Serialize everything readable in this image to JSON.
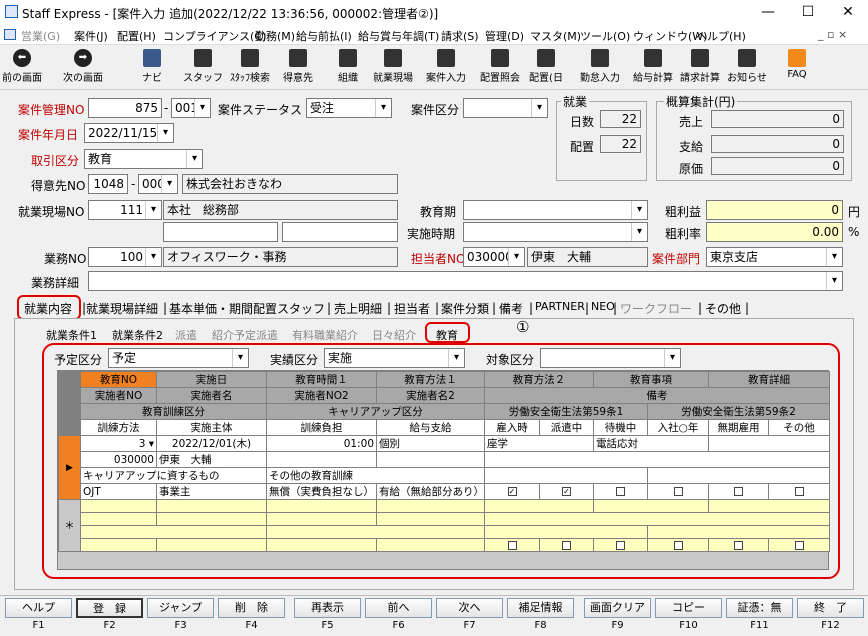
{
  "window": {
    "title": "Staff Express - [案件入力 追加(2022/12/22 13:36:56, 000002:管理者②)]",
    "min": "—",
    "max": "☐",
    "close": "✕"
  },
  "menu": [
    "営業(G)",
    "案件(J)",
    "配置(H)",
    "コンプライアンス(C)",
    "勤務(M)",
    "給与前払(I)",
    "給与賞与年調(T)",
    "請求(S)",
    "管理(D)",
    "マスタ(M)",
    "ツール(O)",
    "ウィンドウ(W)",
    "ヘルプ(H)"
  ],
  "mdi_controls": "_ ▫ ×",
  "toolbar": [
    "前の画面",
    "次の画面",
    "ナビ",
    "スタッフ",
    "ｽﾀｯﾌ検索",
    "得意先",
    "組織",
    "就業現場",
    "案件入力",
    "配置照会",
    "配置(日",
    "勤怠入力",
    "給与計算",
    "請求計算",
    "お知らせ",
    "FAQ"
  ],
  "form": {
    "anken_kanri_no_label": "案件管理NO",
    "anken_kanri_no": "875",
    "anken_kanri_sub": "001",
    "status_label": "案件ステータス",
    "status": "受注",
    "kubun_label": "案件区分",
    "kubun": "",
    "date_label": "案件年月日",
    "date": "2022/11/15",
    "torihiki_label": "取引区分",
    "torihiki": "教育",
    "tokuisaki_label": "得意先NO",
    "tokuisaki_no": "1048",
    "tokuisaki_sub": "000",
    "tokuisaki_name": "株式会社おきなわ",
    "genba_label": "就業現場NO",
    "genba_no": "111",
    "genba_name": "本社　総務部",
    "kyoiku_ki_label": "教育期",
    "kyoiku_ki": "",
    "jisshi_label": "実施時期",
    "jisshi": "",
    "gyomu_label": "業務NO",
    "gyomu_no": "100",
    "gyomu_name": "オフィスワーク・事務",
    "tanto_label": "担当者NO",
    "tanto_no": "030000",
    "tanto_name": "伊東　大輔",
    "bumon_label": "案件部門",
    "bumon": "東京支店",
    "shosai_label": "業務詳細",
    "shosai": ""
  },
  "shugyo": {
    "title": "就業",
    "nissu_label": "日数",
    "nissu": "22",
    "haichi_label": "配置",
    "haichi": "22"
  },
  "gaisan": {
    "title": "概算集計(円)",
    "uriage_label": "売上",
    "uriage": "0",
    "shikyu_label": "支給",
    "shikyu": "0",
    "genka_label": "原価",
    "genka": "0"
  },
  "arari": {
    "label": "粗利益",
    "value": "0",
    "unit": "円",
    "rate_label": "粗利率",
    "rate": "0.00",
    "rate_unit": "%"
  },
  "tabs": [
    "就業内容",
    "就業現場詳細",
    "基本単価・期間配置スタッフ",
    "売上明細",
    "担当者",
    "案件分類",
    "備考",
    "PARTNER",
    "NEO",
    "ワークフロー",
    "その他"
  ],
  "subtabs": [
    "就業条件1",
    "就業条件2",
    "派遣",
    "紹介予定派遣",
    "有料職業紹介",
    "日々紹介",
    "教育"
  ],
  "annotation": "①",
  "filters": {
    "yotei_label": "予定区分",
    "yotei": "予定",
    "jisseki_label": "実績区分",
    "jisseki": "実施",
    "taisho_label": "対象区分",
    "taisho": ""
  },
  "grid": {
    "h1": [
      "教育NO",
      "実施日",
      "教育時間１",
      "教育方法１",
      "教育方法２",
      "教育事項",
      "教育詳細"
    ],
    "h2": [
      "実施者NO",
      "実施者名",
      "実施者NO2",
      "実施者名2",
      "備考"
    ],
    "h3": [
      "教育訓練区分",
      "キャリアアップ区分",
      "労働安全衛生法第59条1",
      "労働安全衛生法第59条2"
    ],
    "h4": [
      "訓練方法",
      "実施主体",
      "訓練負担",
      "給与支給",
      "雇入時",
      "派遣中",
      "待機中",
      "入社○年",
      "無期雇用",
      "その他"
    ],
    "row": {
      "no": "3",
      "date": "2022/12/01(木)",
      "time": "01:00",
      "method1": "個別",
      "method2": "座学",
      "jiko": "電話応対",
      "staff_no": "030000",
      "staff_name": "伊東　大輔",
      "kyoiku_kubun": "キャリアアップに資するもの",
      "career_kubun": "その他の教育訓練",
      "kunren": "OJT",
      "shutai": "事業主",
      "futan": "無償（実費負担なし）",
      "kyuyo": "有給（無給部分あり）"
    },
    "new_marker": "＊"
  },
  "fkeys": [
    {
      "label": "ヘルプ",
      "key": "F1"
    },
    {
      "label": "登　録",
      "key": "F2"
    },
    {
      "label": "ジャンプ",
      "key": "F3"
    },
    {
      "label": "削　除",
      "key": "F4"
    },
    {
      "label": "再表示",
      "key": "F5"
    },
    {
      "label": "前へ",
      "key": "F6"
    },
    {
      "label": "次へ",
      "key": "F7"
    },
    {
      "label": "補足情報",
      "key": "F8"
    },
    {
      "label": "画面クリア",
      "key": "F9"
    },
    {
      "label": "コピー",
      "key": "F10"
    },
    {
      "label": "証憑：無",
      "key": "F11"
    },
    {
      "label": "終　了",
      "key": "F12"
    }
  ]
}
